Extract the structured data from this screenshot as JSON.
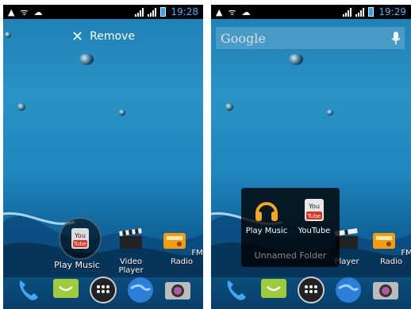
{
  "left": {
    "status": {
      "time": "19:28"
    },
    "remove_label": "Remove",
    "apps": [
      {
        "label": "Play Music"
      },
      {
        "label": "Video Player"
      },
      {
        "label": "FM Radio"
      }
    ],
    "dragging_label": "YouTube"
  },
  "right": {
    "status": {
      "time": "19:29"
    },
    "search_logo": "Google",
    "folder": {
      "name_placeholder": "Unnamed Folder",
      "items": [
        {
          "label": "Play Music",
          "icon": "headphones-icon"
        },
        {
          "label": "YouTube",
          "icon": "youtube-icon"
        }
      ]
    },
    "apps": [
      {
        "label": "Player"
      },
      {
        "label": "FM Radio"
      }
    ]
  },
  "youtube_icon_text": {
    "top": "You",
    "bottom": "Tube"
  },
  "dock": [
    "phone-icon",
    "messaging-icon",
    "app-drawer-icon",
    "browser-icon",
    "camera-icon"
  ],
  "colors": {
    "accent": "#3fb0ff",
    "wallpaper": "#1f86bd"
  }
}
